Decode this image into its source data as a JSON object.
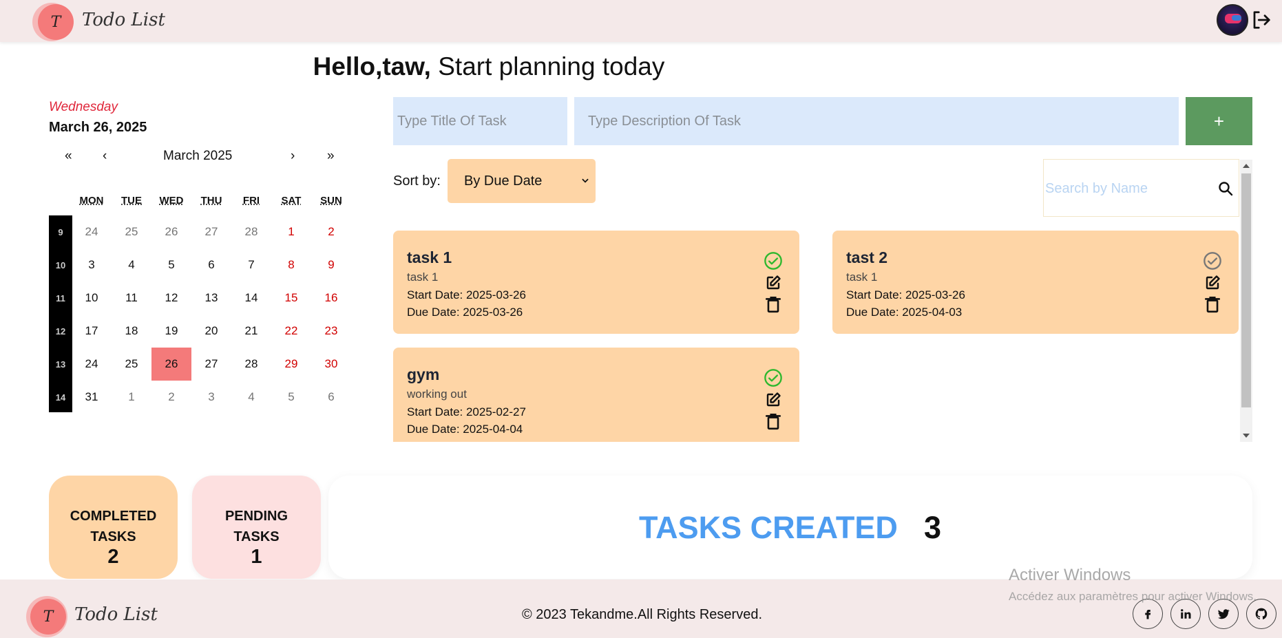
{
  "app": {
    "logo_letter": "T",
    "name": "Todo List"
  },
  "header": {
    "avatar_alt": "avatar-icon",
    "logout_icon": "logout-icon"
  },
  "greeting": {
    "hello": "Hello,taw,",
    "rest": " Start planning today"
  },
  "calendar": {
    "weekday": "Wednesday",
    "full_date": "March 26, 2025",
    "nav": {
      "prev_year": "«",
      "prev_month": "‹",
      "label": "March 2025",
      "next_month": "›",
      "next_year": "»"
    },
    "headers": [
      "MON",
      "TUE",
      "WED",
      "THU",
      "FRI",
      "SAT",
      "SUN"
    ],
    "week_numbers": [
      "9",
      "10",
      "11",
      "12",
      "13",
      "14"
    ],
    "weeks": [
      [
        {
          "d": "24",
          "t": "muted"
        },
        {
          "d": "25",
          "t": "muted"
        },
        {
          "d": "26",
          "t": "muted"
        },
        {
          "d": "27",
          "t": "muted"
        },
        {
          "d": "28",
          "t": "muted"
        },
        {
          "d": "1",
          "t": "weekend"
        },
        {
          "d": "2",
          "t": "weekend"
        }
      ],
      [
        {
          "d": "3",
          "t": ""
        },
        {
          "d": "4",
          "t": ""
        },
        {
          "d": "5",
          "t": ""
        },
        {
          "d": "6",
          "t": ""
        },
        {
          "d": "7",
          "t": ""
        },
        {
          "d": "8",
          "t": "weekend"
        },
        {
          "d": "9",
          "t": "weekend"
        }
      ],
      [
        {
          "d": "10",
          "t": ""
        },
        {
          "d": "11",
          "t": ""
        },
        {
          "d": "12",
          "t": ""
        },
        {
          "d": "13",
          "t": ""
        },
        {
          "d": "14",
          "t": ""
        },
        {
          "d": "15",
          "t": "weekend"
        },
        {
          "d": "16",
          "t": "weekend"
        }
      ],
      [
        {
          "d": "17",
          "t": ""
        },
        {
          "d": "18",
          "t": ""
        },
        {
          "d": "19",
          "t": ""
        },
        {
          "d": "20",
          "t": ""
        },
        {
          "d": "21",
          "t": ""
        },
        {
          "d": "22",
          "t": "weekend"
        },
        {
          "d": "23",
          "t": "weekend"
        }
      ],
      [
        {
          "d": "24",
          "t": ""
        },
        {
          "d": "25",
          "t": ""
        },
        {
          "d": "26",
          "t": "today"
        },
        {
          "d": "27",
          "t": ""
        },
        {
          "d": "28",
          "t": ""
        },
        {
          "d": "29",
          "t": "weekend"
        },
        {
          "d": "30",
          "t": "weekend"
        }
      ],
      [
        {
          "d": "31",
          "t": ""
        },
        {
          "d": "1",
          "t": "muted"
        },
        {
          "d": "2",
          "t": "muted"
        },
        {
          "d": "3",
          "t": "muted"
        },
        {
          "d": "4",
          "t": "muted"
        },
        {
          "d": "5",
          "t": "muted"
        },
        {
          "d": "6",
          "t": "muted"
        }
      ]
    ]
  },
  "form": {
    "title_placeholder": "Type Title Of Task",
    "title_value": "",
    "desc_placeholder": "Type Description Of Task",
    "desc_value": "",
    "add_label": "+"
  },
  "sort": {
    "label": "Sort by:",
    "selected": "By Due Date"
  },
  "search": {
    "placeholder": "Search by Name",
    "value": ""
  },
  "tasks": [
    {
      "title": "task 1",
      "description": "task 1",
      "start": "Start Date: 2025-03-26",
      "due": "Due Date: 2025-03-26",
      "completed": true
    },
    {
      "title": "tast 2",
      "description": "task 1",
      "start": "Start Date: 2025-03-26",
      "due": "Due Date: 2025-04-03",
      "completed": false
    },
    {
      "title": "gym",
      "description": "working out",
      "start": "Start Date: 2025-02-27",
      "due": "Due Date: 2025-04-04",
      "completed": true
    }
  ],
  "stats": {
    "completed_label_1": "COMPLETED",
    "completed_label_2": "TASKS",
    "completed_value": "2",
    "pending_label_1": "PENDING",
    "pending_label_2": "TASKS",
    "pending_value": "1",
    "created_label": "TASKS CREATED",
    "created_value": "3"
  },
  "footer": {
    "copyright": "© 2023 Tekandme.All Rights Reserved.",
    "socials": [
      "facebook-icon",
      "linkedin-icon",
      "twitter-icon",
      "github-icon"
    ]
  },
  "watermark": {
    "line1": "Activer Windows",
    "line2": "Accédez aux paramètres pour activer Windows."
  },
  "colors": {
    "task_card": "#fed5a6",
    "done_check": "#2eb82e",
    "pending_check": "#777777",
    "add_button": "#5c9a5f",
    "input_bg": "#dbe9fb",
    "today": "#f47a7a",
    "weekend": "#d10000",
    "created_label": "#4d9cf0"
  }
}
